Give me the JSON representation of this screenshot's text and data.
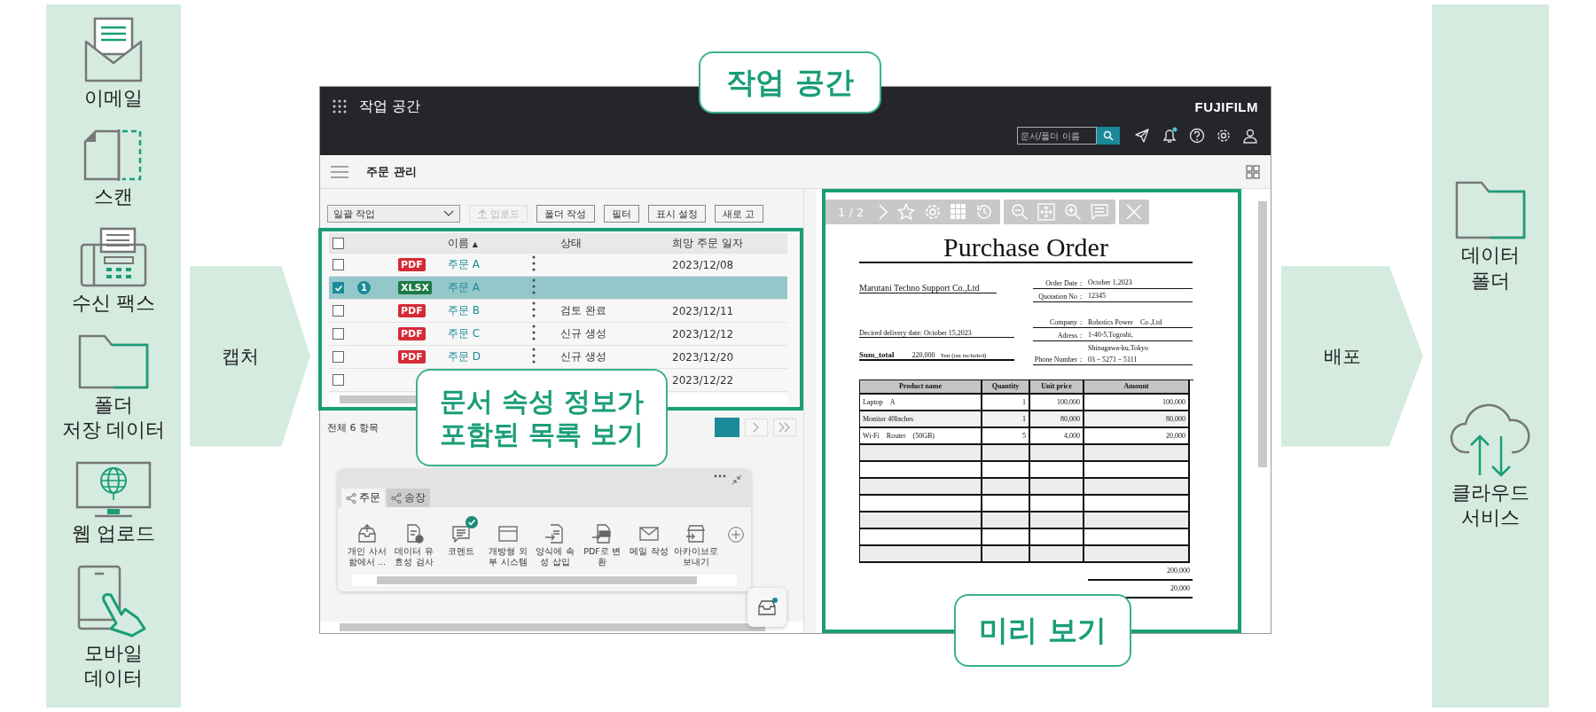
{
  "sources": [
    {
      "label": "이메일",
      "kind": "email"
    },
    {
      "label": "스캔",
      "kind": "scan"
    },
    {
      "label": "수신 팩스",
      "kind": "fax"
    },
    {
      "label": "폴더\n저장 데이터",
      "kind": "folder"
    },
    {
      "label": "웹 업로드",
      "kind": "web"
    },
    {
      "label": "모바일\n데이터",
      "kind": "mobile"
    }
  ],
  "capture": "캡처",
  "app": {
    "title": "작업 공간",
    "logo": "FUJIFILM",
    "search_placeholder": "문서/폴더 이름",
    "notification": true,
    "page_title": "주문 관리",
    "bulk_select": "일괄 작업",
    "toolbar": [
      {
        "label": "업로드",
        "disabled": true,
        "kind": "upload"
      },
      {
        "label": "폴더 작성",
        "disabled": false
      },
      {
        "label": "필터",
        "disabled": false
      },
      {
        "label": "표시 설정",
        "disabled": false
      },
      {
        "label": "새로 고",
        "disabled": false
      }
    ],
    "all_checked": false,
    "columns": [
      {
        "label": "이름",
        "sort": "▲"
      },
      {
        "label": "상태"
      },
      {
        "label": "희망 주문 일자"
      }
    ],
    "rows": [
      {
        "checked": false,
        "selected": false,
        "kind": "pdf",
        "type": "PDF",
        "name": "주문 A",
        "date": "2023/12/08"
      },
      {
        "checked": true,
        "selected": true,
        "badge": "1",
        "kind": "xlsx",
        "type": "XLSX",
        "name": "주문 A"
      },
      {
        "checked": false,
        "selected": false,
        "kind": "pdf",
        "type": "PDF",
        "name": "주문 B",
        "status": "검토 완료",
        "date": "2023/12/11"
      },
      {
        "checked": false,
        "selected": false,
        "kind": "pdf",
        "type": "PDF",
        "name": "주문 C",
        "status": "신규 생성",
        "date": "2023/12/12"
      },
      {
        "checked": false,
        "selected": false,
        "kind": "pdf",
        "type": "PDF",
        "name": "주문 D",
        "status": "신규 생성",
        "date": "2023/12/20"
      },
      {
        "checked": false,
        "selected": false,
        "date": "2023/12/22"
      }
    ],
    "total": "전체 6 항목",
    "panel_tabs": [
      {
        "label": "주문",
        "selected": true
      },
      {
        "label": "송장",
        "selected": false
      }
    ],
    "actions": [
      {
        "label": "개인 사서함에서 ...",
        "kind": "inbox",
        "checked": false
      },
      {
        "label": "데이터 유효성 검사",
        "kind": "validate",
        "checked": false
      },
      {
        "label": "코멘트",
        "kind": "comment",
        "checked": true
      },
      {
        "label": "개방형 외부 시스템",
        "kind": "window",
        "checked": false
      },
      {
        "label": "양식에 속성 삽입",
        "kind": "insert",
        "checked": false
      },
      {
        "label": "PDF로 변환",
        "kind": "pdf",
        "checked": false
      },
      {
        "label": "메일 작성",
        "kind": "mail",
        "checked": false
      },
      {
        "label": "아카이브로 보내기",
        "kind": "archive",
        "checked": false
      }
    ],
    "inbox_notification": true,
    "preview": {
      "page": "1 / 2",
      "document": {
        "title": "Purchase Order",
        "buyer": "Marutani Techno Support Co.,Ltd",
        "fields": [
          {
            "label": "Order Date：",
            "value": "October 1,2023"
          },
          {
            "label": "Quotation No：",
            "value": "12345"
          },
          {
            "label": "Company：",
            "value": "Robotics Power　Co.,Ltd"
          },
          {
            "label": "Adress：",
            "value": "1-40-5,Togoshi,"
          },
          {
            "value": "Shinagawa-ku,Tokyo"
          },
          {
            "label": "Phone Number：",
            "value": "03－5271－5111"
          }
        ],
        "delivery": "Decired delivery date: October 15,2023",
        "sum_label": "Sum_total",
        "sum_value": "220,000",
        "sum_unit": "Yen (tax included)",
        "columns": [
          "Product name",
          "Quantity",
          "Unit price",
          "Amount"
        ],
        "items": [
          [
            "Laptop　A",
            "1",
            "100,000",
            "100,000"
          ],
          [
            "Monitor 40Inches",
            "1",
            "80,000",
            "80,000"
          ],
          [
            "Wi-Fi　Router　(50GB)",
            "5",
            "4,000",
            "20,000"
          ]
        ],
        "totals": [
          "200,000",
          "20,000"
        ]
      }
    }
  },
  "callouts": {
    "workspace": "작업 공간",
    "list": "문서 속성 정보가\n포함된 목록 보기",
    "preview": "미리 보기"
  },
  "distribute": "배포",
  "destinations": [
    {
      "label": "데이터\n폴더",
      "kind": "folder"
    },
    {
      "label": "클라우드\n서비스",
      "kind": "cloud"
    }
  ]
}
